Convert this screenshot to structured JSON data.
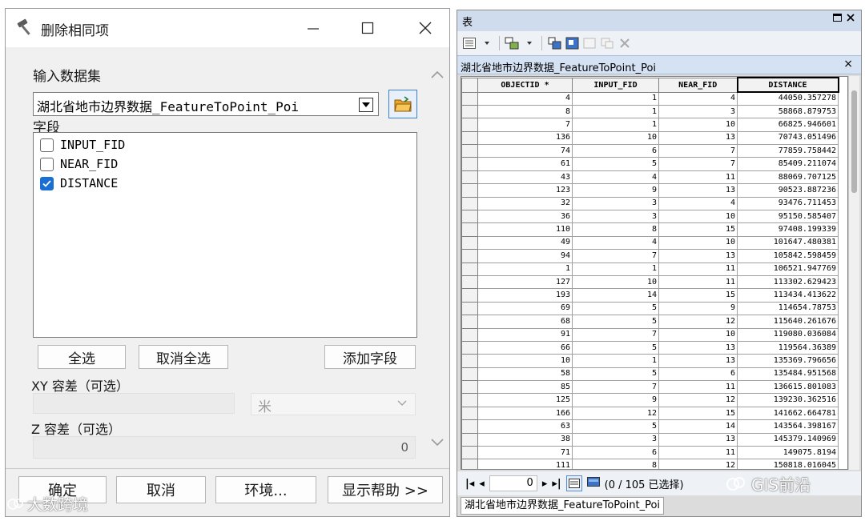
{
  "dialog": {
    "title": "删除相同项",
    "input_label": "输入数据集",
    "input_value": "湖北省地市边界数据_FeatureToPoint_Poi",
    "fields_label": "字段",
    "fields": [
      {
        "name": "INPUT_FID",
        "checked": false
      },
      {
        "name": "NEAR_FID",
        "checked": false
      },
      {
        "name": "DISTANCE",
        "checked": true
      }
    ],
    "select_all": "全选",
    "deselect_all": "取消全选",
    "add_field": "添加字段",
    "xy_label": "XY 容差（可选）",
    "xy_unit": "米",
    "z_label": "Z 容差（可选）",
    "z_value": "0",
    "ok": "确定",
    "cancel": "取消",
    "env": "环境...",
    "help": "显示帮助 >>"
  },
  "table_window": {
    "title": "表",
    "tab": "湖北省地市边界数据_FeatureToPoint_Poi",
    "columns": [
      "OBJECTID *",
      "INPUT_FID",
      "NEAR_FID",
      "DISTANCE"
    ],
    "rows": [
      [
        "4",
        "1",
        "4",
        "44050.357278"
      ],
      [
        "8",
        "1",
        "3",
        "58868.879753"
      ],
      [
        "7",
        "1",
        "10",
        "66825.946601"
      ],
      [
        "136",
        "10",
        "13",
        "70743.051496"
      ],
      [
        "74",
        "6",
        "7",
        "77859.758442"
      ],
      [
        "61",
        "5",
        "7",
        "85409.211074"
      ],
      [
        "43",
        "4",
        "11",
        "88069.707125"
      ],
      [
        "123",
        "9",
        "13",
        "90523.887236"
      ],
      [
        "32",
        "3",
        "4",
        "93476.711453"
      ],
      [
        "36",
        "3",
        "10",
        "95150.585407"
      ],
      [
        "110",
        "8",
        "15",
        "97408.199339"
      ],
      [
        "49",
        "4",
        "10",
        "101647.480381"
      ],
      [
        "94",
        "7",
        "13",
        "105842.598459"
      ],
      [
        "1",
        "1",
        "11",
        "106521.947769"
      ],
      [
        "127",
        "10",
        "11",
        "113302.629423"
      ],
      [
        "193",
        "14",
        "15",
        "113434.413622"
      ],
      [
        "69",
        "5",
        "9",
        "114654.78753"
      ],
      [
        "68",
        "5",
        "12",
        "115640.261676"
      ],
      [
        "91",
        "7",
        "10",
        "119080.036084"
      ],
      [
        "66",
        "5",
        "13",
        "119564.36389"
      ],
      [
        "10",
        "1",
        "13",
        "135369.796656"
      ],
      [
        "58",
        "5",
        "6",
        "135484.951568"
      ],
      [
        "85",
        "7",
        "11",
        "136615.801083"
      ],
      [
        "125",
        "9",
        "12",
        "139230.362516"
      ],
      [
        "166",
        "12",
        "15",
        "141662.664781"
      ],
      [
        "63",
        "5",
        "14",
        "143564.398167"
      ],
      [
        "38",
        "3",
        "13",
        "145379.140969"
      ],
      [
        "71",
        "6",
        "11",
        "149075.8194"
      ],
      [
        "111",
        "8",
        "12",
        "150818.016045"
      ]
    ],
    "nav_value": "0",
    "status": "(0 / 105 已选择)",
    "bottom_tab": "湖北省地市边界数据_FeatureToPoint_Poi"
  },
  "watermarks": {
    "left": "大数跨境",
    "right": "GIS前沿"
  }
}
